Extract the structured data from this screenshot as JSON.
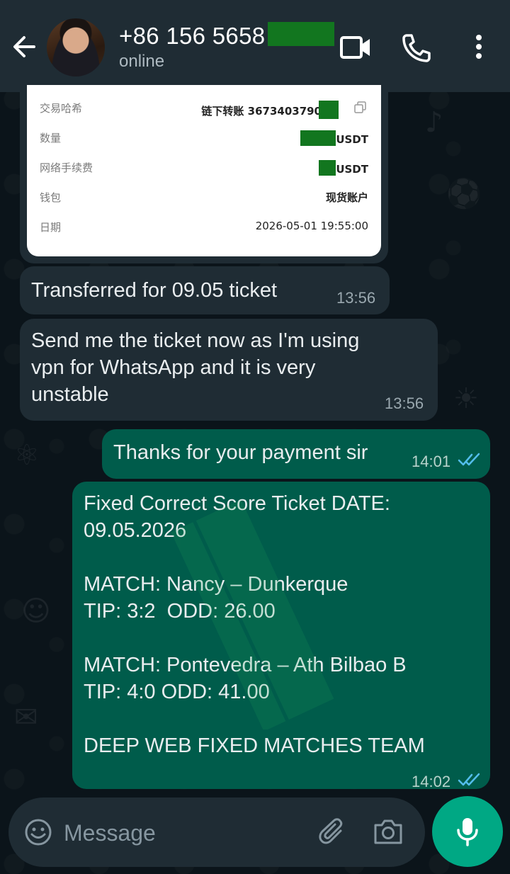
{
  "header": {
    "contact_name": "+86 156 5658",
    "status": "online"
  },
  "screenshot_card": {
    "rows": [
      {
        "label": "交易哈希",
        "value": "链下转账 3673403790"
      },
      {
        "label": "数量",
        "value": "USDT"
      },
      {
        "label": "网络手续费",
        "value": "USDT"
      },
      {
        "label": "钱包",
        "value": "现货账户"
      },
      {
        "label": "日期",
        "value": "2026-05-01 19:55:00"
      }
    ]
  },
  "messages": [
    {
      "direction": "in",
      "text": "Transferred for 09.05 ticket",
      "time": "13:56"
    },
    {
      "direction": "in",
      "text": "Send me the ticket now as I'm using\nvpn for WhatsApp and it is very\nunstable",
      "time": "13:56"
    },
    {
      "direction": "out",
      "text": "Thanks for your payment sir",
      "time": "14:01"
    },
    {
      "direction": "out",
      "text": "Fixed Correct Score Ticket DATE:\n09.05.2026\n\nMATCH: Nancy – Dunkerque\nTIP: 3:2  ODD: 26.00\n\nMATCH: Pontevedra – Ath Bilbao B\nTIP: 4:0 ODD: 41.00\n\nDEEP WEB FIXED MATCHES TEAM",
      "time": "14:02"
    }
  ],
  "composer": {
    "placeholder": "Message"
  },
  "icons": [
    "back-arrow-icon",
    "video-call-icon",
    "voice-call-icon",
    "more-options-icon",
    "copy-icon",
    "read-ticks-icon",
    "emoji-icon",
    "attach-icon",
    "camera-icon",
    "mic-icon"
  ],
  "colors": {
    "header": "#1f2c34",
    "chat_background": "#0b141a",
    "incoming_bubble": "#1f2c34",
    "outgoing_bubble": "#005c4b",
    "read_ticks": "#53bdeb",
    "mic_button": "#00a884",
    "redaction": "#12761f"
  }
}
